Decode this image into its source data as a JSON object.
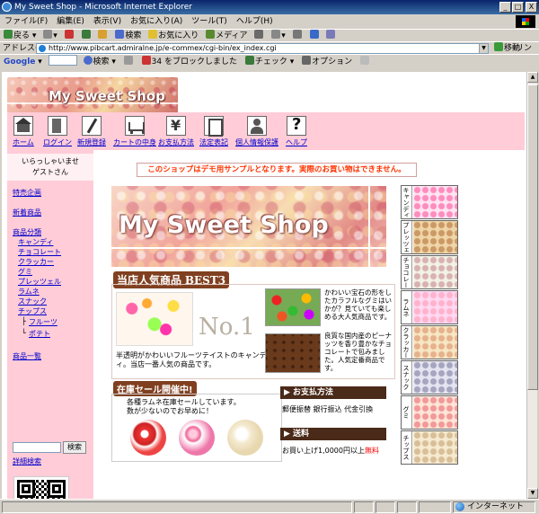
{
  "window": {
    "title": "My Sweet Shop - Microsoft Internet Explorer",
    "buttons": [
      "_",
      "□",
      "X"
    ]
  },
  "menubar": {
    "items": [
      "ファイル(F)",
      "編集(E)",
      "表示(V)",
      "お気に入り(A)",
      "ツール(T)",
      "ヘルプ(H)"
    ]
  },
  "toolbar": {
    "back": "戻る",
    "search": "検索",
    "favorites": "お気に入り",
    "media": "メディア"
  },
  "addressbar": {
    "label": "アドレス(D)",
    "url": "http://www.pibcart.admiralne.jp/e-commex/cgi-bin/ex_index.cgi",
    "go": "移動",
    "links": "リンク"
  },
  "googlebar": {
    "logo": "Google",
    "search": "検索",
    "blocked": "34 をブロックしました",
    "check": "チェック",
    "options": "オプション"
  },
  "statusbar": {
    "zone": "インターネット"
  },
  "shop": {
    "logo_text": "My Sweet Shop",
    "hero_title": "My Sweet Shop",
    "nav": [
      {
        "label": "ホーム",
        "icon": "home-icon"
      },
      {
        "label": "ログイン",
        "icon": "login-door-icon"
      },
      {
        "label": "新規登録",
        "icon": "register-pen-icon"
      },
      {
        "label": "カートの中身",
        "icon": "cart-icon"
      },
      {
        "label": "お支払方法",
        "icon": "yen-icon"
      },
      {
        "label": "法定表記",
        "icon": "document-icon"
      },
      {
        "label": "個人情報保護",
        "icon": "person-icon"
      },
      {
        "label": "ヘルプ",
        "icon": "help-icon"
      }
    ],
    "welcome_line1": "いらっしゃいませ",
    "welcome_line2": "ゲストさん",
    "special": "特売企画",
    "new_items": "新着商品",
    "categories_label": "商品分類",
    "categories": [
      "キャンディ",
      "チョコレート",
      "クラッカー",
      "グミ",
      "プレッツェル",
      "ラムネ",
      "スナック",
      "チップス"
    ],
    "chips_sub": [
      "フルーツ",
      "ポテト"
    ],
    "product_list": "商品一覧",
    "search_button": "検索",
    "advanced_search": "詳細検索",
    "demo_notice": "このショップはデモ用サンプルとなります。実際のお買い物はできません。",
    "cat_tabs": [
      "キャンディ",
      "プレッツェル",
      "チョコレート",
      "ラムネ",
      "クラッカー",
      "スナック",
      "グミ",
      "チップス"
    ],
    "best_heading_jp": "当店人気商品",
    "best_heading_en": "BEST3",
    "no1_mark": "No.1",
    "no1_text": "半透明がかわいいフルーツテイストのキャンディ。当店一番人気の商品です。",
    "gummy_text": "かわいい宝石の形をしたカラフルなグミはいかが？見ていても楽しめる大人気商品です。",
    "choc_text": "良質な国内産のピーナッツを香り豊かなチョコレートで包みました。人気定番商品です。",
    "sale_heading": "在庫セール開催中!",
    "sale_text_1": "各種ラムネ在庫セールしています。",
    "sale_text_2": "数が少ないのでお早めに！",
    "payment_heading": "▶ お支払方法",
    "payment_text": "郵便振替 銀行振込 代金引換",
    "shipping_heading": "▶ 送料",
    "shipping_text": "お買い上げ1,0000円以上",
    "shipping_free": "無料"
  }
}
